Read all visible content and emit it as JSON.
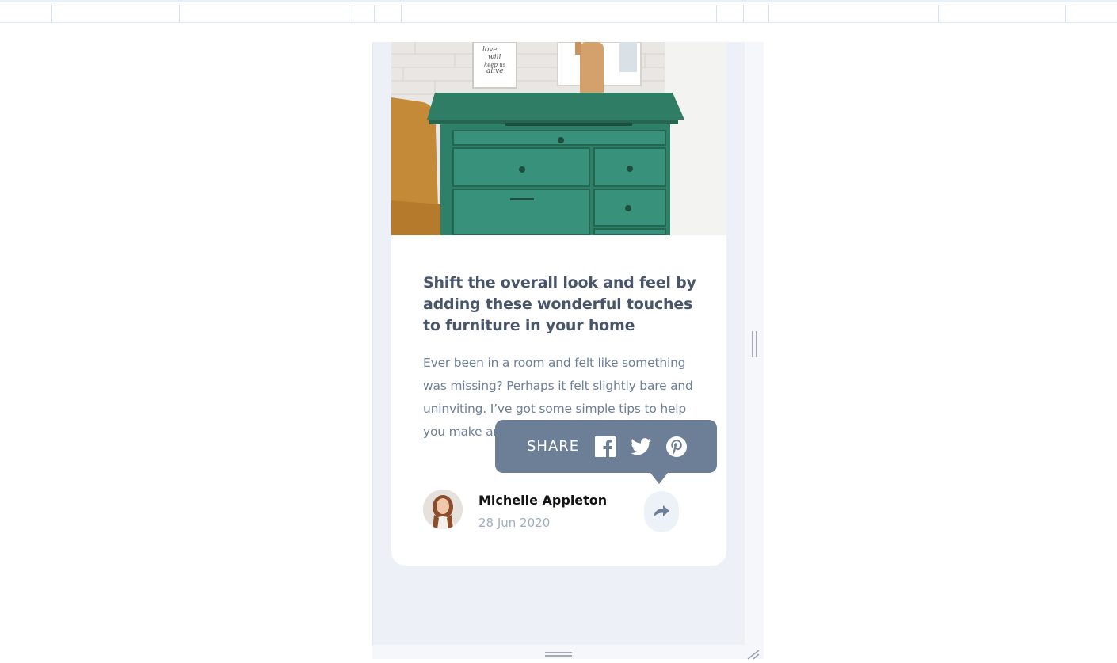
{
  "article": {
    "title": "Shift the overall look and feel by adding these wonderful touches to furniture in your home",
    "excerpt": "Ever been in a room and felt like something was missing? Perhaps it felt slightly bare and uninviting. I’ve got some simple tips to help you make any room feel complete.",
    "image_icon": "furniture-photo",
    "poster_text": "love will keep us alive"
  },
  "author": {
    "name": "Michelle Appleton",
    "date": "28 Jun 2020",
    "avatar_icon": "author-avatar"
  },
  "share": {
    "label": "SHARE",
    "icons": [
      "facebook-icon",
      "twitter-icon",
      "pinterest-icon"
    ],
    "button_icon": "share-arrow-icon"
  },
  "colors": {
    "title": "#48556a",
    "text": "#6e8098",
    "date": "#9eafc2",
    "popover": "#6d7f97",
    "share_button_bg": "#ecf2f8",
    "page_bg": "#edf1f7"
  }
}
